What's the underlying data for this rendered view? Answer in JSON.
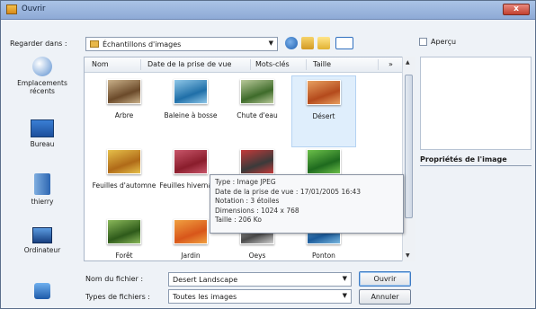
{
  "window": {
    "title": "Ouvrir",
    "close_glyph": "x"
  },
  "toolbar": {
    "look_in_label": "Regarder dans :",
    "look_in_value": "Échantillons d'images",
    "nav_icons": [
      "back-icon",
      "up-folder-icon",
      "new-folder-icon",
      "view-menu-icon"
    ],
    "preview_label": "Aperçu"
  },
  "places": [
    {
      "name": "recent",
      "label": "Emplacements récents"
    },
    {
      "name": "desktop",
      "label": "Bureau"
    },
    {
      "name": "user",
      "label": "thierry"
    },
    {
      "name": "computer",
      "label": "Ordinateur"
    },
    {
      "name": "network",
      "label": ""
    }
  ],
  "columns": [
    "Nom",
    "Date de la prise de vue",
    "Mots-clés",
    "Taille",
    "»"
  ],
  "files": [
    {
      "name": "Arbre",
      "c1": "#6b4a2a",
      "c2": "#c9b089"
    },
    {
      "name": "Baleine à bosse",
      "c1": "#1f6fa8",
      "c2": "#8fc7e8"
    },
    {
      "name": "Chute d'eau",
      "c1": "#3e6b2a",
      "c2": "#b9c99a"
    },
    {
      "name": "Désert",
      "c1": "#b44a1c",
      "c2": "#e8a060"
    },
    {
      "name": "Feuilles d'automne",
      "c1": "#b06a18",
      "c2": "#e6c04a"
    },
    {
      "name": "Feuilles hivernales",
      "c1": "#8a1d2c",
      "c2": "#c8566a"
    },
    {
      "name": "",
      "c1": "#3a3a3a",
      "c2": "#c43a3a"
    },
    {
      "name": "",
      "c1": "#1e6a1e",
      "c2": "#6cc04a"
    },
    {
      "name": "Forêt",
      "c1": "#2e5a1a",
      "c2": "#8ab85a"
    },
    {
      "name": "Jardin",
      "c1": "#d8561a",
      "c2": "#f0a040"
    },
    {
      "name": "Oeys",
      "c1": "#4a4a4a",
      "c2": "#d0d0d0"
    },
    {
      "name": "Ponton",
      "c1": "#1a5a9a",
      "c2": "#7ab8e0"
    }
  ],
  "tooltip": {
    "lines": [
      "Type : Image JPEG",
      "Date de la prise de vue : 17/01/2005 16:43",
      "Notation : 3 étoiles",
      "Dimensions : 1024 x 768",
      "Taille : 206 Ko"
    ]
  },
  "properties_title": "Propriétés de l'image",
  "filename": {
    "label": "Nom du fichier :",
    "value": "Desert Landscape"
  },
  "filetype": {
    "label": "Types de fichiers :",
    "value": "Toutes les images"
  },
  "buttons": {
    "open": "Ouvrir",
    "cancel": "Annuler"
  }
}
